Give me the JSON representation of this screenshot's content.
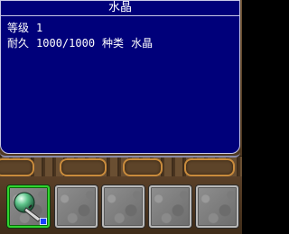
{
  "item": {
    "name": "水晶",
    "level_label": "等级",
    "level_value": "1",
    "durability_label": "耐久",
    "durability_value": "1000/1000",
    "type_label": "种类",
    "type_value": "水晶"
  },
  "colors": {
    "panel_bg": "#00007a",
    "text": "#ffffff",
    "selected_slot_border": "#2fd42f",
    "ornament": "#c98b3c"
  },
  "inventory": {
    "slots": [
      {
        "item": "crystal-orb",
        "selected": true
      },
      {
        "item": "",
        "selected": false
      },
      {
        "item": "",
        "selected": false
      },
      {
        "item": "",
        "selected": false
      },
      {
        "item": "",
        "selected": false
      }
    ]
  }
}
